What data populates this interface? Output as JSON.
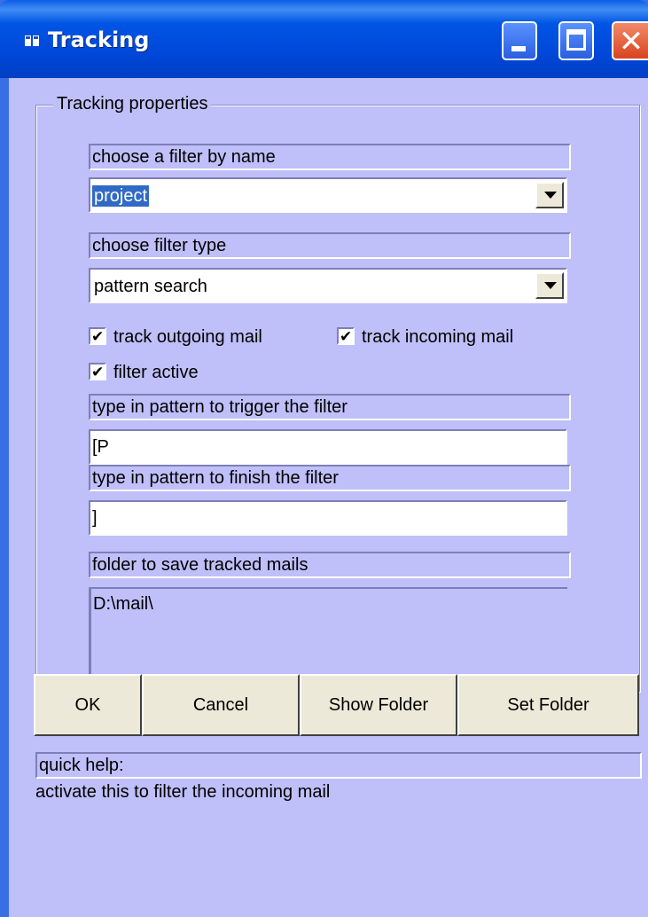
{
  "window": {
    "title": "Tracking",
    "icon": "app-icon",
    "controls": {
      "minimize": "minimize-icon",
      "maximize": "maximize-icon",
      "close": "close-icon"
    }
  },
  "group": {
    "label": "Tracking properties"
  },
  "filter_name": {
    "label": "choose a filter by name",
    "value": "project"
  },
  "filter_type": {
    "label": "choose filter type",
    "value": "pattern search"
  },
  "checks": {
    "outgoing": {
      "label": "track outgoing mail",
      "checked": true
    },
    "incoming": {
      "label": "track incoming mail",
      "checked": true
    },
    "active": {
      "label": "filter active",
      "checked": true
    },
    "mark": "✔"
  },
  "trigger": {
    "label": "type in pattern to trigger the filter",
    "value": "[P"
  },
  "finish": {
    "label": "type in pattern to finish the filter",
    "value": "]"
  },
  "folder": {
    "label": "folder to save tracked mails",
    "value": "D:\\mail\\"
  },
  "buttons": {
    "ok": "OK",
    "cancel": "Cancel",
    "show_folder": "Show Folder",
    "set_folder": "Set Folder"
  },
  "help": {
    "label": "quick help:",
    "text": "activate this to filter the incoming mail"
  },
  "colors": {
    "client_bg": "#bfbff9",
    "titlebar": "#0055e5",
    "selection": "#316ac5",
    "button_face": "#ece9d8"
  }
}
